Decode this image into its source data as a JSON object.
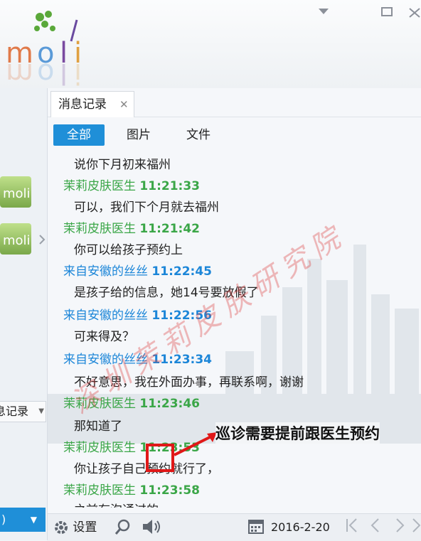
{
  "app": {
    "logo_text": "moli"
  },
  "window": {
    "controls": [
      "minimize-arrow",
      "maximize",
      "close"
    ]
  },
  "left": {
    "record_label": "息记录",
    "blue_button_label": ")"
  },
  "tabs": [
    {
      "label": "消息记录"
    }
  ],
  "filters": [
    {
      "label": "全部"
    },
    {
      "label": "图片"
    },
    {
      "label": "文件"
    }
  ],
  "messages": [
    {
      "type": "body",
      "text": "说你下月初来福州"
    },
    {
      "type": "sender",
      "name": "茉莉皮肤医生",
      "time": "11:21:33",
      "color": "green"
    },
    {
      "type": "body",
      "text": "可以，我们下个月就去福州"
    },
    {
      "type": "sender",
      "name": "茉莉皮肤医生",
      "time": "11:21:42",
      "color": "green"
    },
    {
      "type": "body",
      "text": "你可以给孩子预约上"
    },
    {
      "type": "sender",
      "name": "来自安徽的丝丝",
      "time": "11:22:45",
      "color": "blue"
    },
    {
      "type": "body",
      "text": "是孩子给的信息，她14号要放假了"
    },
    {
      "type": "sender",
      "name": "来自安徽的丝丝",
      "time": "11:22:56",
      "color": "blue"
    },
    {
      "type": "body",
      "text": "可来得及？"
    },
    {
      "type": "sender",
      "name": "来自安徽的丝丝",
      "time": "11:23:34",
      "color": "blue"
    },
    {
      "type": "body",
      "text": "不好意思，我在外面办事，再联系啊，谢谢"
    },
    {
      "type": "sender",
      "name": "茉莉皮肤医生",
      "time": "11:23:46",
      "color": "green"
    },
    {
      "type": "body",
      "text": "那知道了"
    },
    {
      "type": "sender",
      "name": "茉莉皮肤医生",
      "time": "11:23:53",
      "color": "green"
    },
    {
      "type": "body",
      "text": "你让孩子自己预约就行了，"
    },
    {
      "type": "sender",
      "name": "茉莉皮肤医生",
      "time": "11:23:58",
      "color": "green"
    },
    {
      "type": "body",
      "text": "之前有沟通过的"
    }
  ],
  "watermark": "深圳茉莉皮肤研究院",
  "annotation": "巡诊需要提前跟医生预约",
  "toolbar": {
    "settings_label": "设置",
    "date": "2016-2-20"
  },
  "colors": {
    "accent": "#1f8fd8",
    "green": "#3aa647",
    "blue": "#1c86d8",
    "highlight": "#e01818"
  }
}
